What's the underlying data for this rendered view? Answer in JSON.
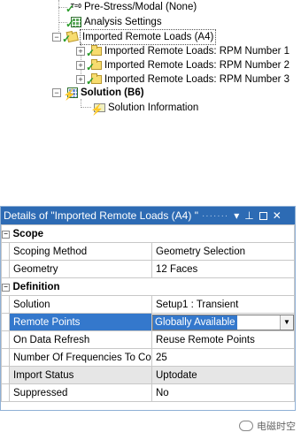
{
  "tree": {
    "items": [
      {
        "label": "Pre-Stress/Modal (None)",
        "icon": "pre-stress-icon"
      },
      {
        "label": "Analysis Settings",
        "icon": "analysis-settings-icon"
      },
      {
        "label": "Imported Remote Loads (A4)",
        "icon": "folder-icon"
      },
      {
        "label": "Imported Remote Loads: RPM Number 1",
        "icon": "folder-icon"
      },
      {
        "label": "Imported Remote Loads: RPM Number 2",
        "icon": "folder-icon"
      },
      {
        "label": "Imported Remote Loads: RPM Number 3",
        "icon": "folder-icon"
      },
      {
        "label": "Solution (B6)",
        "icon": "solution-icon"
      },
      {
        "label": "Solution Information",
        "icon": "solution-information-icon"
      }
    ]
  },
  "details": {
    "title": "Details of \"Imported Remote Loads (A4) \"",
    "title_controls": [
      "menu",
      "pin",
      "maximize",
      "close"
    ],
    "sections": [
      {
        "name": "Scope",
        "rows": [
          {
            "label": "Scoping Method",
            "value": "Geometry Selection"
          },
          {
            "label": "Geometry",
            "value": "12 Faces"
          }
        ]
      },
      {
        "name": "Definition",
        "rows": [
          {
            "label": "Solution",
            "value": "Setup1 : Transient"
          },
          {
            "label": "Remote Points",
            "value": "Globally Available"
          },
          {
            "label": "On Data Refresh",
            "value": "Reuse Remote Points"
          },
          {
            "label": "Number Of Frequencies To Consider",
            "value": "25"
          },
          {
            "label": "Import Status",
            "value": "Uptodate"
          },
          {
            "label": "Suppressed",
            "value": "No"
          }
        ]
      }
    ]
  },
  "watermark": {
    "text": "电磁时空"
  },
  "colors": {
    "titlebar": "#2d6bb4",
    "highlight": "#3478cc",
    "check": "#2a9d2a",
    "bolt": "#e6b800"
  }
}
